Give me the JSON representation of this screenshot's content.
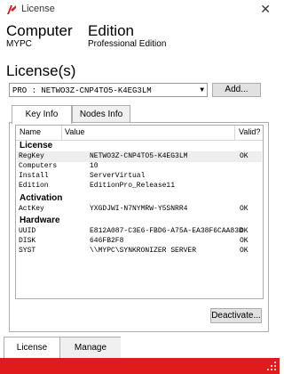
{
  "window": {
    "title": "License",
    "close_glyph": "✕"
  },
  "summary": {
    "computer_heading": "Computer",
    "computer_value": "MYPC",
    "edition_heading": "Edition",
    "edition_value": "Professional Edition"
  },
  "licenses": {
    "label": "License(s)",
    "selected": "PRO : NETWO3Z-CNP4TO5-K4EG3LM",
    "add_label": "Add..."
  },
  "tabs": [
    {
      "label": "Key Info",
      "active": true
    },
    {
      "label": "Nodes Info",
      "active": false
    }
  ],
  "table": {
    "columns": [
      "Name",
      "Value",
      "Valid?"
    ],
    "sections": [
      {
        "title": "License",
        "rows": [
          {
            "name": "RegKey",
            "value": "NETWO3Z-CNP4TO5-K4EG3LM",
            "valid": "OK",
            "selected": true
          },
          {
            "name": "Computers",
            "value": "10",
            "valid": ""
          },
          {
            "name": "Install",
            "value": "ServerVirtual",
            "valid": ""
          },
          {
            "name": "Edition",
            "value": "EditionPro_Release11",
            "valid": ""
          }
        ]
      },
      {
        "title": "Activation",
        "rows": [
          {
            "name": "ActKey",
            "value": "YXGDJWI-N7NYMRW-Y5SNRR4",
            "valid": "OK"
          }
        ]
      },
      {
        "title": "Hardware",
        "rows": [
          {
            "name": "UUID",
            "value": "E812A087-C3E6-FBD6-A75A-EA38F6CAA83D",
            "valid": "OK"
          },
          {
            "name": "DISK",
            "value": "646FB2F8",
            "valid": "OK"
          },
          {
            "name": "SYST",
            "value": "\\\\MYPC\\SYNKRONIZER SERVER",
            "valid": "OK"
          }
        ]
      }
    ]
  },
  "deactivate_label": "Deactivate...",
  "bottom_tabs": [
    {
      "label": "License",
      "active": true
    },
    {
      "label": "Manage",
      "active": false
    }
  ],
  "colors": {
    "accent": "#e01b1b"
  }
}
